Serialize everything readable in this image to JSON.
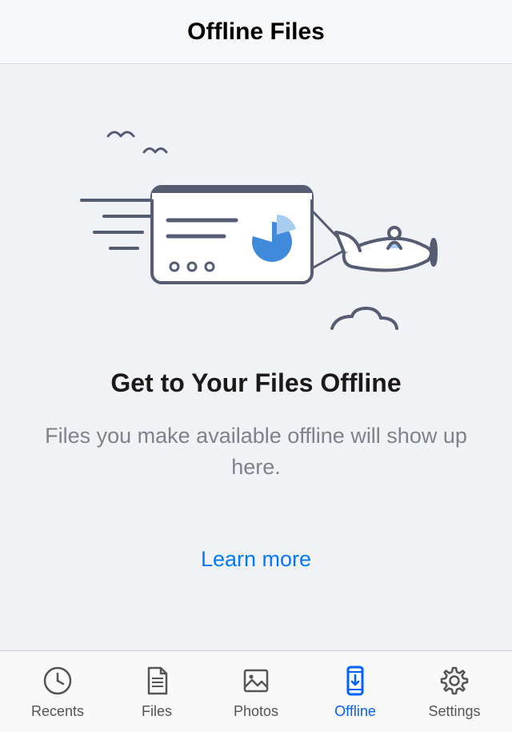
{
  "header": {
    "title": "Offline Files"
  },
  "empty": {
    "heading": "Get to Your Files Offline",
    "subtext": "Files you make available offline will show up here.",
    "learn_more": "Learn more"
  },
  "tabs": {
    "recents": "Recents",
    "files": "Files",
    "photos": "Photos",
    "offline": "Offline",
    "settings": "Settings"
  },
  "colors": {
    "accent": "#0061fe",
    "ill_stroke": "#565c72",
    "ill_blue_dark": "#418adb",
    "ill_blue_light": "#a9cdf0"
  }
}
